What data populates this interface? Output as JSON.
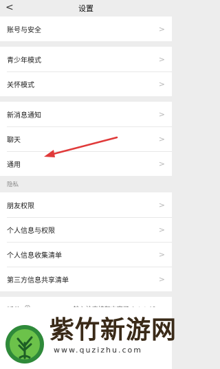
{
  "header": {
    "back_glyph": "<",
    "title": "设置"
  },
  "groups": [
    [
      "账号与安全"
    ],
    [
      "青少年模式",
      "关怀模式"
    ],
    [
      "新消息通知",
      "聊天",
      "通用"
    ]
  ],
  "privacy": {
    "section_label": "隐私",
    "items": [
      "朋友权限",
      "个人信息与权限",
      "个人信息收集清单",
      "第三方信息共享清单"
    ]
  },
  "plugin": {
    "label": "插件",
    "desc": "输入法支持颜文字了ᵒ(๑❛ᴗ❛๑)ō"
  },
  "chevron_glyph": ">",
  "annotation_arrow_color": "#e03a3a",
  "watermark": {
    "title": "紫竹新游网",
    "url": "www.quzizhu.com"
  }
}
